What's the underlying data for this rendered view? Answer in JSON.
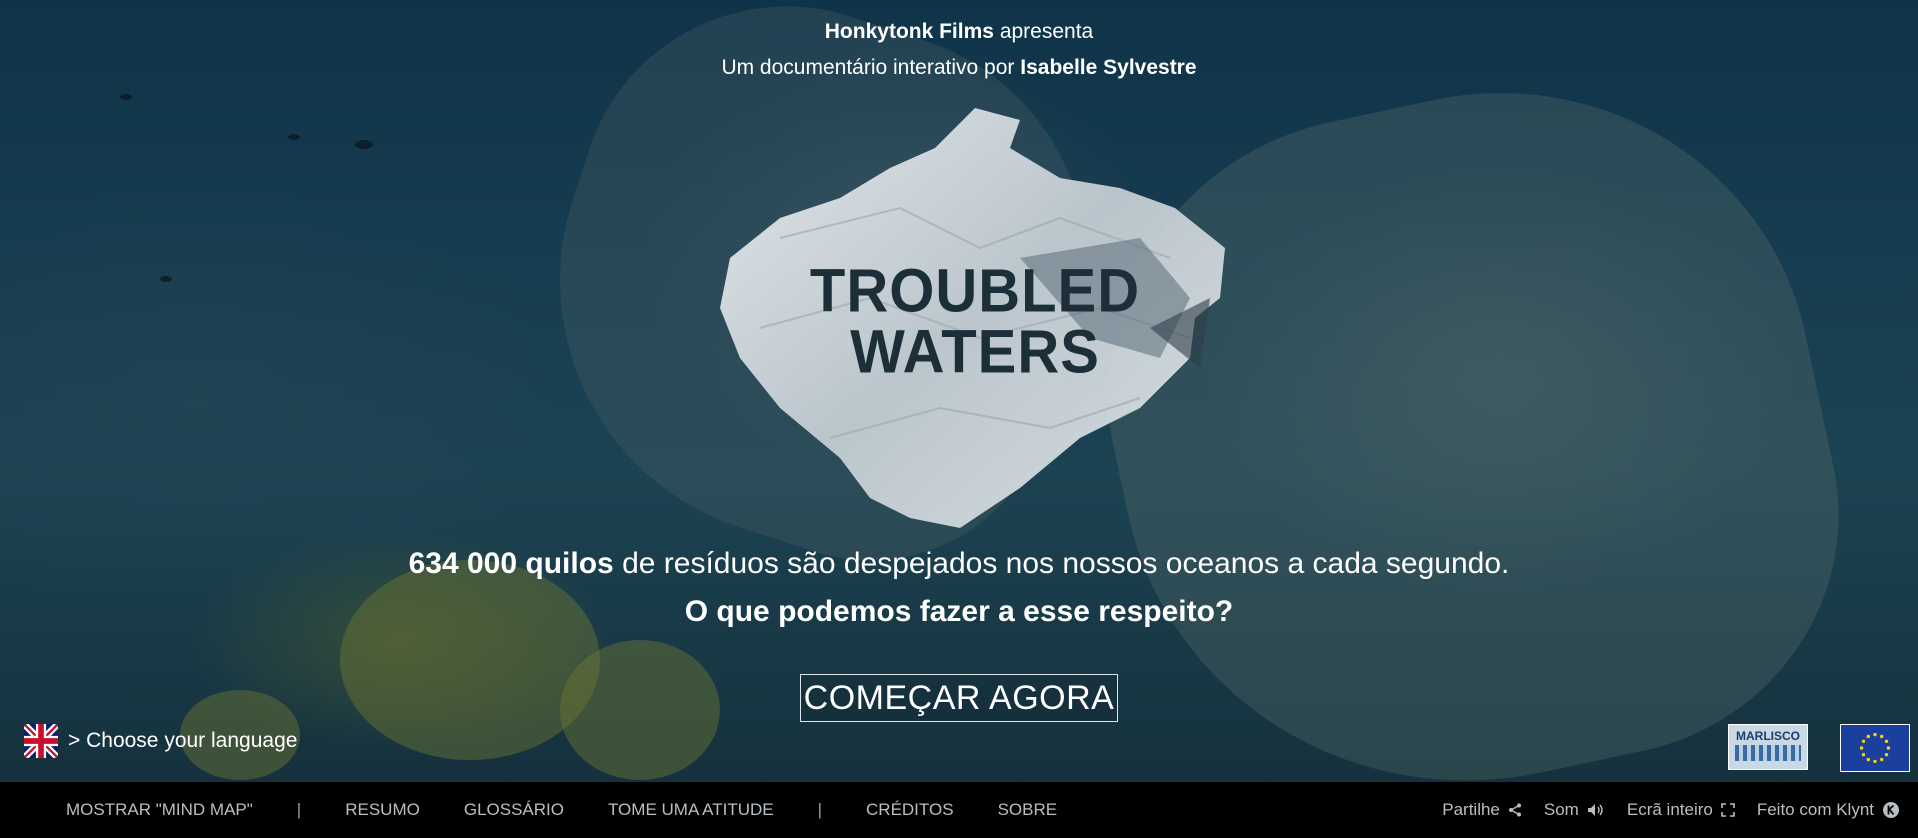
{
  "header": {
    "line1_bold": "Honkytonk Films",
    "line1_rest": "apresenta",
    "line2_rest": "Um documentário interativo por",
    "line2_bold": "Isabelle Sylvestre"
  },
  "logo": {
    "line1": "TROUBLED",
    "line2": "WATERS"
  },
  "tagline": {
    "highlight": "634 000 quilos",
    "rest": "de resíduos são despejados nos nossos oceanos a cada segundo.",
    "question": "O que podemos fazer a esse respeito?"
  },
  "cta": {
    "label": "COMEÇAR AGORA"
  },
  "language": {
    "label": "> Choose your language",
    "flag_icon": "uk-flag-icon"
  },
  "partners": {
    "marlisco": "MARLISCO",
    "eu_icon": "eu-flag-icon"
  },
  "bottom_nav": {
    "items": [
      "MOSTRAR \"MIND MAP\"",
      "|",
      "RESUMO",
      "GLOSSÁRIO",
      "TOME UMA ATITUDE",
      "|",
      "CRÉDITOS",
      "SOBRE"
    ]
  },
  "tools": {
    "share": "Partilhe",
    "sound": "Som",
    "fullscreen": "Ecrã inteiro",
    "made_with": "Feito com Klynt"
  },
  "colors": {
    "bar_bg": "#000000",
    "nav_text": "#b9bec2",
    "logo_text": "#1c2e38"
  }
}
